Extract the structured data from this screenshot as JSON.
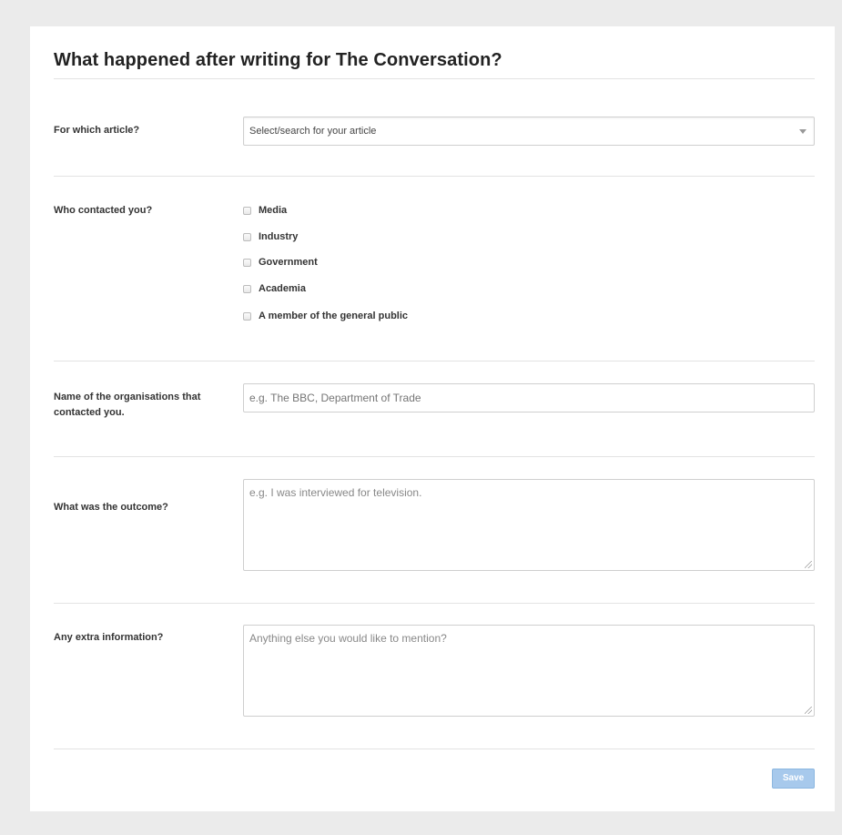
{
  "form": {
    "title": "What happened after writing for The Conversation?",
    "article": {
      "label": "For which article?",
      "selected": "Select/search for your article"
    },
    "contacts": {
      "label": "Who contacted you?",
      "options": [
        "Media",
        "Industry",
        "Government",
        "Academia",
        "A member of the general public"
      ]
    },
    "organisations": {
      "label": "Name of the organisations that contacted you.",
      "placeholder": "e.g. The BBC, Department of Trade"
    },
    "outcome": {
      "label": "What was the outcome?",
      "placeholder": "e.g. I was interviewed for television."
    },
    "extra": {
      "label": "Any extra information?",
      "placeholder": "Anything else you would like to mention?"
    },
    "save_label": "Save"
  },
  "colors": {
    "page_background": "#ebebeb",
    "card_background": "#ffffff",
    "save_button": "#a7c9ec"
  },
  "icons": {
    "select_arrow": "chevron-down-icon",
    "resize_grip": "resize-grip-icon"
  }
}
